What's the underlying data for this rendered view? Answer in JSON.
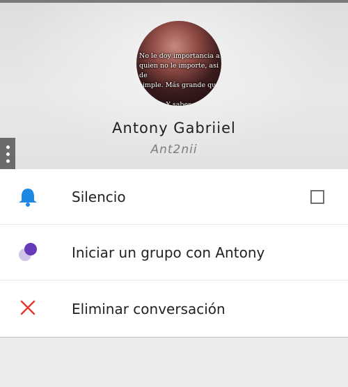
{
  "profile": {
    "avatar_quote": "No le doy importancia a\nquien no le importe, asi de\nsimple. Más grande que yo\nderra... Y sabes que? Y\nando!!!",
    "name": "Antony Gabriiel",
    "username": "Ant2nii"
  },
  "menu": {
    "items": [
      {
        "label": "Silencio",
        "icon": "bell-icon",
        "icon_color": "#1e88e5",
        "checked": false
      },
      {
        "label": "Iniciar un grupo con Antony",
        "icon": "group-icon",
        "icon_color": "#673ab7"
      },
      {
        "label": "Eliminar conversación",
        "icon": "close-icon",
        "icon_color": "#e53935"
      }
    ]
  },
  "colors": {
    "accent_blue": "#1e88e5",
    "purple": "#673ab7",
    "danger_red": "#e53935"
  }
}
